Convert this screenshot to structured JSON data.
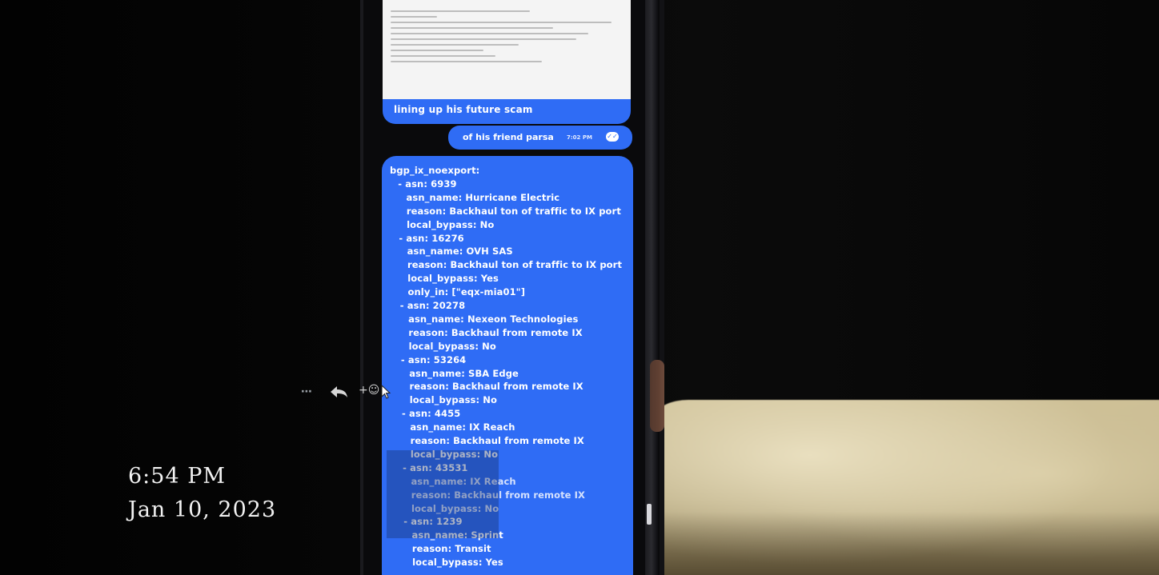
{
  "conversation": {
    "incoming_caption": "lining up his future scam",
    "outgoing_message": "of his friend parsa",
    "outgoing_time": "7:02 PM",
    "read_receipt_icon": "read-receipt-icon",
    "yaml_lines": [
      "bgp_ix_noexport:",
      "  - asn: 6939",
      "    asn_name: Hurricane Electric",
      "    reason: Backhaul ton of traffic to IX port",
      "    local_bypass: No",
      "  - asn: 16276",
      "    asn_name: OVH SAS",
      "    reason: Backhaul ton of traffic to IX port",
      "    local_bypass: Yes",
      "    only_in: [\"eqx-mia01\"]",
      "  - asn: 20278",
      "    asn_name: Nexeon Technologies",
      "    reason: Backhaul from remote IX",
      "    local_bypass: No",
      "  - asn: 53264",
      "    asn_name: SBA Edge",
      "    reason: Backhaul from remote IX",
      "    local_bypass: No",
      "  - asn: 4455",
      "    asn_name: IX Reach",
      "    reason: Backhaul from remote IX",
      "    local_bypass: No",
      "  - asn: 43531",
      "    asn_name: IX Reach",
      "    reason: Backhaul from remote IX",
      "    local_bypass: No",
      "  - asn: 1239",
      "    asn_name: Sprint",
      "    reason: Transit",
      "    local_bypass: Yes"
    ]
  },
  "message_actions": {
    "more": "⋯",
    "reply_icon": "reply-icon",
    "react": "+☺",
    "cursor_icon": "pointer-cursor-icon"
  },
  "overlay": {
    "time": "6:54 PM",
    "date": "Jan 10, 2023"
  },
  "colors": {
    "bubble": "#2f6cf5",
    "background": "#050505",
    "text": "#ffffff"
  }
}
